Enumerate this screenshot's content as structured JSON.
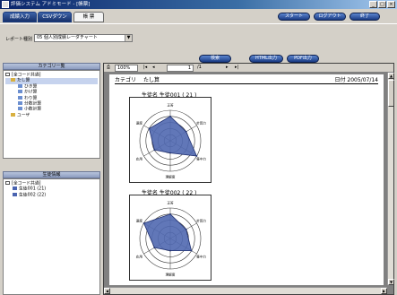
{
  "window": {
    "title": "評価システム アドミモード - [帳票]"
  },
  "tabs": [
    {
      "label": "成績入力",
      "active": false
    },
    {
      "label": "CSVダウン",
      "active": false
    },
    {
      "label": "帳 票",
      "active": true
    }
  ],
  "top_buttons": [
    "スタート",
    "ログアウト",
    "終了"
  ],
  "report_select": {
    "label": "レポート種別",
    "value": "05 個人別成績レーダチャート"
  },
  "action_buttons": [
    "検索",
    "HTML出力",
    "PDF出力"
  ],
  "category_panel": {
    "title": "カテゴリ一覧",
    "items": [
      "[全コード共通]",
      "たし算",
      "ひき算",
      "かけ算",
      "わり算",
      "分数計算",
      "小数計算",
      "ユーザ"
    ]
  },
  "student_panel": {
    "title": "生徒情報",
    "items": [
      "[全コード共通]",
      "生徒001 (21)",
      "生徒002 (22)"
    ]
  },
  "viewer": {
    "zoom": "100%",
    "page": "1",
    "total": "/1"
  },
  "report": {
    "category_label": "カテゴリ",
    "category_value": "たし算",
    "date_label": "日付",
    "date_value": "2005/07/14"
  },
  "chart_data": [
    {
      "type": "radar",
      "title": "生徒名  生徒001 ( 21 )",
      "axes": [
        "正答",
        "計算力",
        "集中力",
        "理解度",
        "応用",
        "速度"
      ],
      "rmax": 5,
      "values": [
        4,
        3,
        5,
        2,
        3,
        4
      ]
    },
    {
      "type": "radar",
      "title": "生徒名  生徒002 ( 22 )",
      "axes": [
        "正答",
        "計算力",
        "集中力",
        "理解度",
        "応用",
        "速度"
      ],
      "rmax": 5,
      "values": [
        4,
        3,
        4,
        2,
        3,
        5
      ]
    }
  ],
  "colors": {
    "radar_fill": "#5068b0",
    "radar_stroke": "#203070",
    "tab_active": "#f4f4f4"
  }
}
